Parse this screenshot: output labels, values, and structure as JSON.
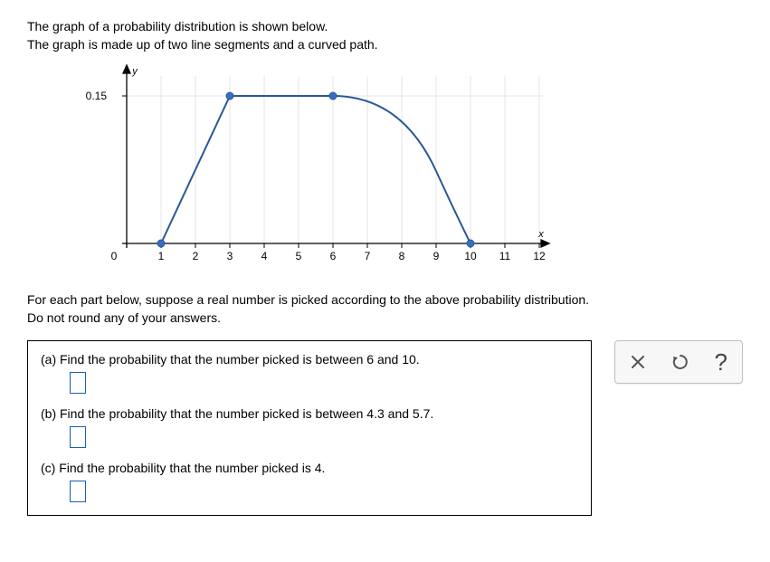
{
  "intro": {
    "line1": "The graph of a probability distribution is shown below.",
    "line2": "The graph is made up of two line segments and a curved path."
  },
  "chart_data": {
    "type": "line",
    "title": "",
    "xlabel": "x",
    "ylabel": "y",
    "xlim": [
      0,
      13
    ],
    "ylim": [
      0,
      0.17
    ],
    "xticks": [
      0,
      1,
      2,
      3,
      4,
      5,
      6,
      7,
      8,
      9,
      10,
      11,
      12
    ],
    "yticks": [
      0.15
    ],
    "series": [
      {
        "name": "segment1",
        "kind": "line",
        "points": [
          {
            "x": 1,
            "y": 0
          },
          {
            "x": 3,
            "y": 0.15
          }
        ]
      },
      {
        "name": "segment2",
        "kind": "line",
        "points": [
          {
            "x": 3,
            "y": 0.15
          },
          {
            "x": 6,
            "y": 0.15
          }
        ]
      },
      {
        "name": "curve",
        "kind": "curve",
        "points": [
          {
            "x": 6,
            "y": 0.15
          },
          {
            "x": 10,
            "y": 0
          }
        ]
      }
    ],
    "marked_points": [
      {
        "x": 1,
        "y": 0
      },
      {
        "x": 3,
        "y": 0.15
      },
      {
        "x": 6,
        "y": 0.15
      },
      {
        "x": 10,
        "y": 0
      }
    ]
  },
  "instructions": {
    "line1": "For each part below, suppose a real number is picked according to the above probability distribution.",
    "line2": "Do not round any of your answers."
  },
  "questions": {
    "a": "(a) Find the probability that the number picked is between 6 and 10.",
    "b": "(b) Find the probability that the number picked is between 4.3 and 5.7.",
    "c": "(c) Find the probability that the number picked is 4."
  },
  "answers": {
    "a": "",
    "b": "",
    "c": ""
  },
  "controls": {
    "clear": "clear",
    "reset": "reset",
    "help": "?"
  }
}
